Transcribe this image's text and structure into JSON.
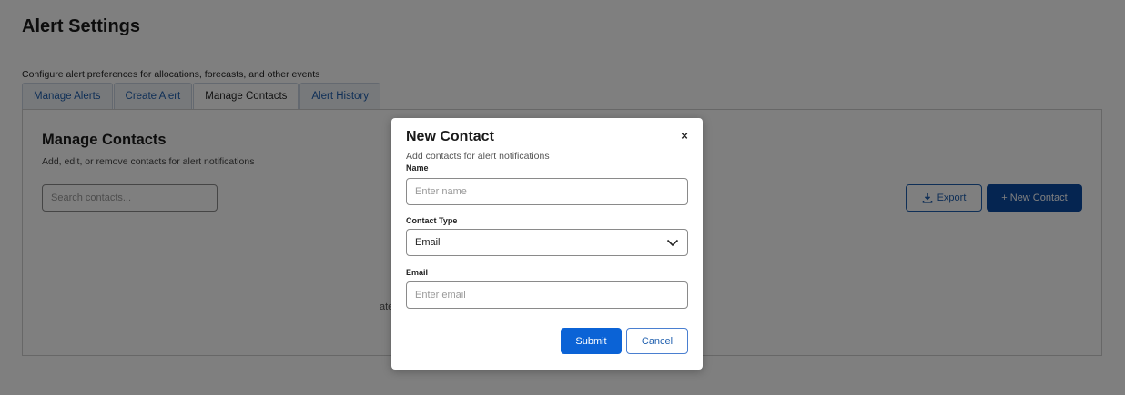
{
  "page": {
    "title": "Alert Settings",
    "subtitle": "Configure alert preferences for allocations, forecasts, and other events"
  },
  "tabs": [
    {
      "label": "Manage Alerts",
      "active": false
    },
    {
      "label": "Create Alert",
      "active": false
    },
    {
      "label": "Manage Contacts",
      "active": true
    },
    {
      "label": "Alert History",
      "active": false
    }
  ],
  "panel": {
    "title": "Manage Contacts",
    "subtitle": "Add, edit, or remove contacts for alert notifications",
    "search_placeholder": "Search contacts...",
    "export_label": "Export",
    "new_contact_label": "+ New Contact",
    "empty_text_visible": "ater."
  },
  "modal": {
    "title": "New Contact",
    "subtitle": "Add contacts for alert notifications",
    "name_label": "Name",
    "name_placeholder": "Enter name",
    "contact_type_label": "Contact Type",
    "contact_type_value": "Email",
    "email_label": "Email",
    "email_placeholder": "Enter email",
    "submit_label": "Submit",
    "cancel_label": "Cancel",
    "close_glyph": "×"
  },
  "icons": {
    "export": "download-icon",
    "close": "close-icon",
    "dropdown": "chevron-down-icon"
  },
  "colors": {
    "primary": "#0b4aa2",
    "submit": "#0b63d6",
    "link": "#1f5fae"
  }
}
